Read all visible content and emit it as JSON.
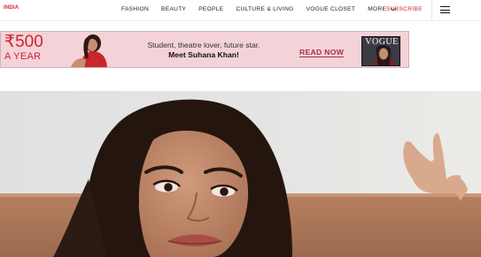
{
  "header": {
    "brand": "INDIA",
    "nav": [
      "FASHION",
      "BEAUTY",
      "PEOPLE",
      "CULTURE & LIVING",
      "VOGUE CLOSET",
      "MORE"
    ],
    "subscribe": "SUBSCRIBE",
    "menu_icon": "hamburger-menu-icon"
  },
  "ad": {
    "price": "₹500",
    "period": "A YEAR",
    "line1": "Student, theatre lover, future star.",
    "line2": "Meet Suhana Khan!",
    "cta": "READ NOW",
    "magazine_title": "VOGUE"
  },
  "colors": {
    "brand_accent": "#d0232f",
    "subscribe": "#d0232f",
    "ad_background": "#f3d2d8",
    "cta": "#a8323f"
  }
}
